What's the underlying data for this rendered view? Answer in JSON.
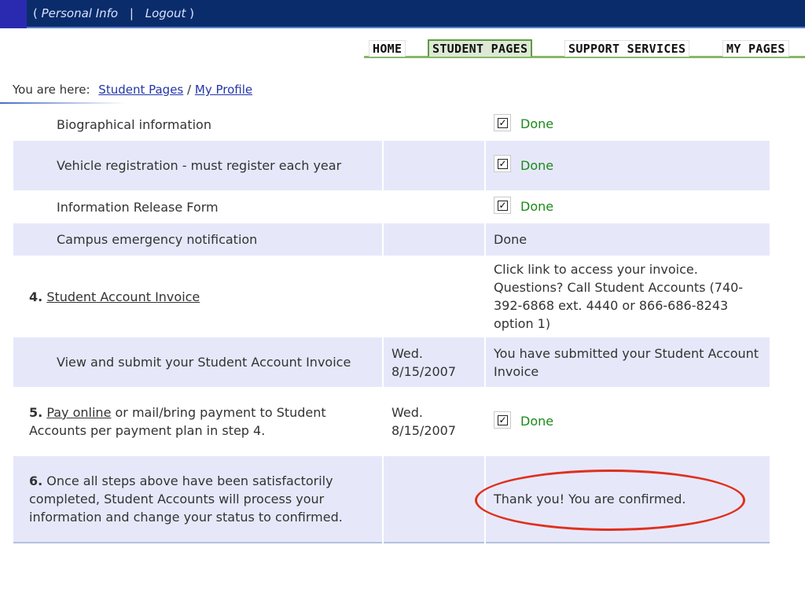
{
  "topbar": {
    "personal_info": "Personal Info",
    "separator": "|",
    "logout": "Logout",
    "open_paren": "(",
    "close_paren": ")"
  },
  "nav": {
    "tabs": [
      {
        "label": "HOME"
      },
      {
        "label": "STUDENT PAGES"
      },
      {
        "label": "SUPPORT SERVICES"
      },
      {
        "label": "MY PAGES"
      }
    ],
    "active_tab": "STUDENT PAGES"
  },
  "breadcrumb": {
    "label": "You are here:",
    "items": [
      "Student Pages",
      "My Profile"
    ],
    "separator": "/"
  },
  "rows": {
    "bio": {
      "label": "Biographical information",
      "status": "Done",
      "checked": true
    },
    "vehicle": {
      "label": "Vehicle registration - must register each year",
      "status": "Done",
      "checked": true
    },
    "release": {
      "label": "Information Release Form",
      "status": "Done",
      "checked": true
    },
    "emergency": {
      "label": "Campus emergency notification",
      "status": "Done"
    },
    "step4": {
      "num": "4.",
      "link": "Student Account Invoice",
      "note": "Click link to access your invoice. Questions? Call Student Accounts (740-392-6868 ext. 4440 or 866-686-8243 option 1)"
    },
    "invoice": {
      "label": "View and submit your Student Account Invoice",
      "date": "Wed. 8/15/2007",
      "status": "You have submitted your Student Account Invoice"
    },
    "step5": {
      "num": "5.",
      "link": "Pay online",
      "text": " or mail/bring payment to Student Accounts per payment plan in step 4.",
      "date": "Wed. 8/15/2007",
      "status": "Done",
      "checked": true
    },
    "step6": {
      "num": "6.",
      "text": " Once all steps above have been satisfactorily completed, Student Accounts will process your information and change your status to confirmed.",
      "status": "Thank you! You are confirmed."
    }
  },
  "colors": {
    "topbar": "#0b2c6b",
    "done_green": "#1a8a1a",
    "row_alt": "#e6e8fa",
    "annotation_red": "#e0301e",
    "nav_active": "#dde9d4"
  }
}
